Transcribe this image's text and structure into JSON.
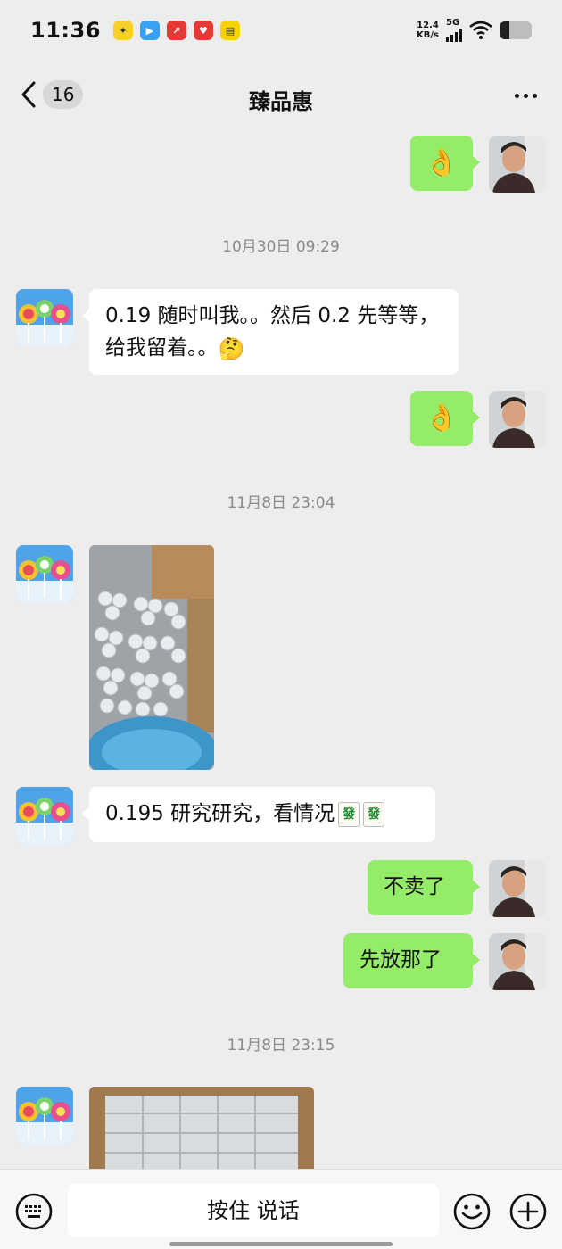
{
  "status_bar": {
    "time": "11:36",
    "net_speed_value": "12.4",
    "net_speed_unit": "KB/s",
    "network": "5G",
    "battery_level": 0.3
  },
  "header": {
    "title": "臻品惠",
    "unread_count": "16"
  },
  "messages": {
    "m1": {
      "side": "right",
      "text": "👌"
    },
    "ts1": "10月30日 09:29",
    "m2": {
      "side": "left",
      "text": "0.19 随时叫我。。然后 0.2 先等等，给我留着。。",
      "emoji": "🤔"
    },
    "m3": {
      "side": "right",
      "text": "👌"
    },
    "ts2": "11月8日 23:04",
    "m4": {
      "side": "left",
      "type": "image"
    },
    "m5": {
      "side": "left",
      "text": "0.195 研究研究，看情况",
      "tiles": [
        "發",
        "發"
      ]
    },
    "m6": {
      "side": "right",
      "text": "不卖了"
    },
    "m7": {
      "side": "right",
      "text": "先放那了"
    },
    "ts3": "11月8日 23:15",
    "m8": {
      "side": "left",
      "type": "image"
    }
  },
  "input_bar": {
    "voice_label": "按住 说话",
    "icons": [
      "keyboard-icon",
      "emoji-icon",
      "plus-icon"
    ]
  },
  "colors": {
    "background": "#ededed",
    "self_bubble": "#95ec69",
    "other_bubble": "#ffffff"
  }
}
